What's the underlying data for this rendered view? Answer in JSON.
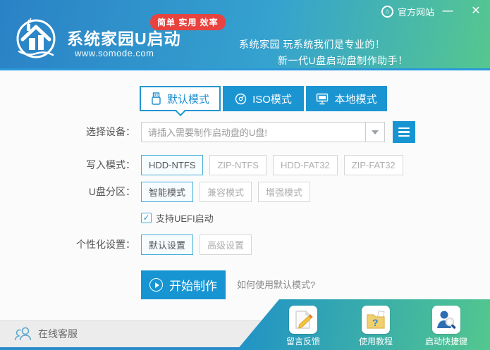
{
  "header": {
    "badge": "简单 实用 效率",
    "title": "系统家园U启动",
    "website": "www.somode.com",
    "slogan_line1": "系统家园 玩系统我们是专业的！",
    "slogan_line2": "新一代U盘启动盘制作助手！",
    "official_site": "官方网站",
    "minimize": "—",
    "close": "✕"
  },
  "tabs": [
    {
      "label": "默认模式",
      "icon": "usb-icon",
      "active": true
    },
    {
      "label": "ISO模式",
      "icon": "disc-icon",
      "active": false
    },
    {
      "label": "本地模式",
      "icon": "monitor-icon",
      "active": false
    }
  ],
  "form": {
    "device_label": "选择设备：",
    "device_value": "请插入需要制作启动盘的U盘!",
    "write_mode_label": "写入模式：",
    "write_modes": [
      "HDD-NTFS",
      "ZIP-NTFS",
      "HDD-FAT32",
      "ZIP-FAT32"
    ],
    "write_mode_selected": "HDD-NTFS",
    "partition_label": "U盘分区：",
    "partitions": [
      "智能模式",
      "兼容模式",
      "增强模式"
    ],
    "partition_selected": "智能模式",
    "uefi_label": "支持UEFI启动",
    "uefi_checked": true,
    "uefi_checkmark": "✓",
    "personalize_label": "个性化设置：",
    "personalize_options": [
      "默认设置",
      "高级设置"
    ],
    "personalize_selected": "默认设置",
    "start_label": "开始制作",
    "help_link": "如何使用默认模式?"
  },
  "footer": {
    "online_service": "在线客服",
    "shortcuts": [
      "留言反馈",
      "使用教程",
      "启动快捷键"
    ]
  },
  "colors": {
    "header_gradient_start": "#2a82c6",
    "header_gradient_end": "#55c78f",
    "accent_blue": "#1795d3",
    "tab_blue": "#1b95d2",
    "badge_red": "#e8433f",
    "active_border": "#45aed8",
    "bottom_strip": "#2b8ccb"
  }
}
